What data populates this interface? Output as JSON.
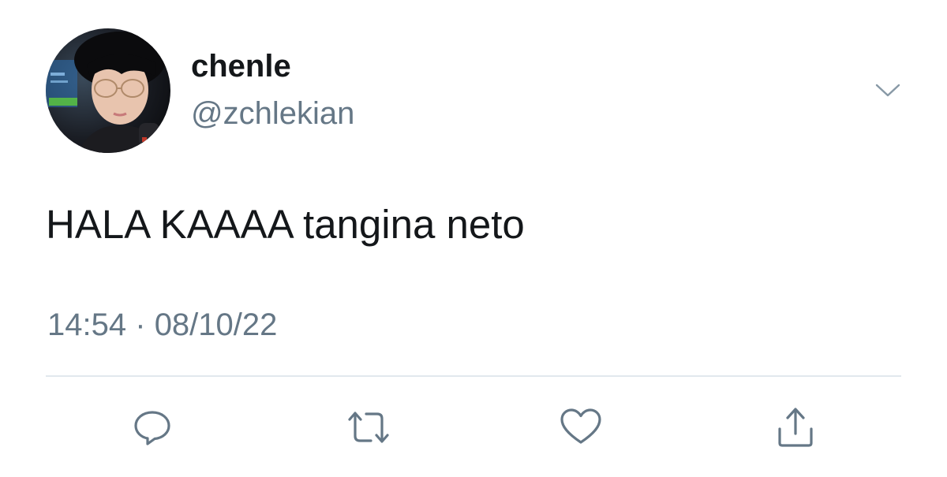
{
  "tweet": {
    "author": {
      "display_name": "chenle",
      "handle": "@zchlekian",
      "avatar_icon": "profile-photo"
    },
    "text": "HALA KAAAA tangina neto",
    "time": "14:54",
    "separator": "·",
    "date": "08/10/22",
    "menu_icon": "chevron-down-icon",
    "actions": [
      {
        "name": "reply",
        "icon": "comment-bubble-icon"
      },
      {
        "name": "retweet",
        "icon": "retweet-icon"
      },
      {
        "name": "like",
        "icon": "heart-icon"
      },
      {
        "name": "share",
        "icon": "share-upload-icon"
      }
    ]
  },
  "colors": {
    "text": "#14171a",
    "secondary": "#657786",
    "divider": "#e1e8ed",
    "icon": "#657786"
  }
}
